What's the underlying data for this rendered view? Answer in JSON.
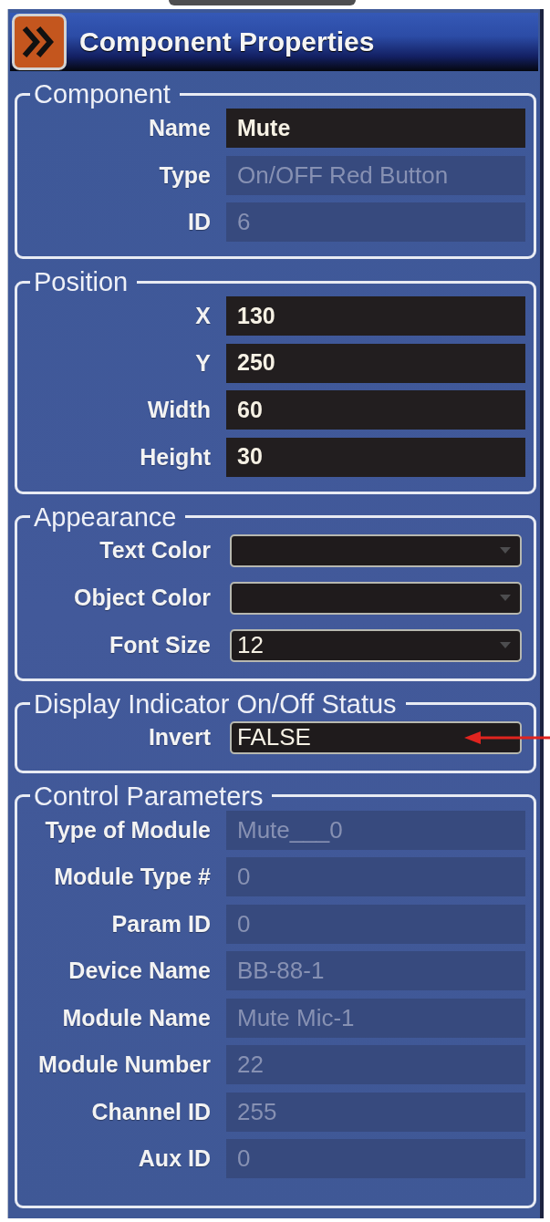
{
  "panel": {
    "title": "Component Properties"
  },
  "groups": [
    {
      "title": "Component",
      "arrow": false,
      "fields": [
        {
          "label": "Name",
          "kind": "text",
          "value": "Mute",
          "disabled": false
        },
        {
          "label": "Type",
          "kind": "text",
          "value": "On/OFF Red Button",
          "disabled": true
        },
        {
          "label": "ID",
          "kind": "text",
          "value": "6",
          "disabled": true
        }
      ]
    },
    {
      "title": "Position",
      "arrow": false,
      "fields": [
        {
          "label": "X",
          "kind": "text",
          "value": "130",
          "disabled": false
        },
        {
          "label": "Y",
          "kind": "text",
          "value": "250",
          "disabled": false
        },
        {
          "label": "Width",
          "kind": "text",
          "value": "60",
          "disabled": false
        },
        {
          "label": "Height",
          "kind": "text",
          "value": "30",
          "disabled": false
        }
      ]
    },
    {
      "title": "Appearance",
      "arrow": false,
      "fields": [
        {
          "label": "Text Color",
          "kind": "dropdown",
          "disabled": false
        },
        {
          "label": "Object Color",
          "kind": "dropdown",
          "disabled": false
        },
        {
          "label": "Font Size",
          "kind": "dropdown",
          "value": "12",
          "disabled": false
        }
      ]
    },
    {
      "title": "Display Indicator On/Off Status",
      "arrow": true,
      "fields": [
        {
          "label": "Invert",
          "kind": "toggle",
          "value": "FALSE",
          "disabled": false
        }
      ]
    },
    {
      "title": "Control Parameters",
      "arrow": false,
      "fields": [
        {
          "label": "Type of Module",
          "kind": "text",
          "value": "Mute___0",
          "disabled": true
        },
        {
          "label": "Module Type #",
          "kind": "text",
          "value": "0",
          "disabled": true
        },
        {
          "label": "Param ID",
          "kind": "text",
          "value": "0",
          "disabled": true
        },
        {
          "label": "Device Name",
          "kind": "text",
          "value": "BB-88-1",
          "disabled": true
        },
        {
          "label": "Module Name",
          "kind": "text",
          "value": "Mute Mic-1",
          "disabled": true
        },
        {
          "label": "Module Number",
          "kind": "text",
          "value": "22",
          "disabled": true
        },
        {
          "label": "Channel ID",
          "kind": "text",
          "value": "255",
          "disabled": true
        },
        {
          "label": "Aux ID",
          "kind": "text",
          "value": "0",
          "disabled": true
        }
      ]
    }
  ]
}
